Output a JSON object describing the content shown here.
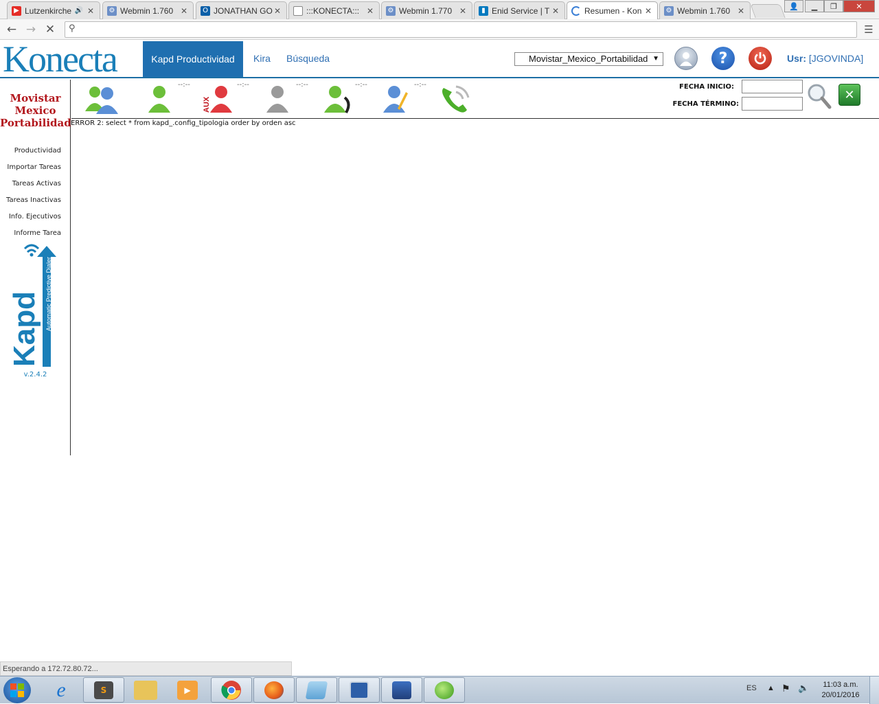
{
  "browser": {
    "tabs": [
      {
        "title": "Lutzenkirche",
        "icon": "youtube-icon",
        "audio": true
      },
      {
        "title": "Webmin 1.760",
        "icon": "webmin-icon"
      },
      {
        "title": "JONATHAN GO",
        "icon": "outlook-icon"
      },
      {
        "title": ":::KONECTA:::",
        "icon": "page-icon"
      },
      {
        "title": "Webmin 1.770",
        "icon": "webmin-icon"
      },
      {
        "title": "Enid Service | T",
        "icon": "trello-icon"
      },
      {
        "title": "Resumen - Kon",
        "icon": "loading-icon",
        "active": true
      },
      {
        "title": "Webmin 1.760",
        "icon": "webmin-icon"
      }
    ],
    "url": ""
  },
  "app": {
    "logo": "Konecta",
    "nav": {
      "active": "Kapd Productividad",
      "items": [
        "Kira",
        "Búsqueda"
      ]
    },
    "campaign_selected": "Movistar_Mexico_Portabilidad",
    "user_label": "Usr:",
    "user_name": "[JGOVINDA]"
  },
  "sidebar": {
    "client_lines": [
      "Movistar",
      "Mexico",
      "Portabilidad"
    ],
    "menu": [
      "Productividad",
      "Importar Tareas",
      "Tareas Activas",
      "Tareas Inactivas",
      "Info. Ejecutivos",
      "Informe Tarea"
    ],
    "kapd_tagline": "Automatic Predictive Dialer",
    "version": "v.2.4.2"
  },
  "status_icons": [
    {
      "name": "all-agents",
      "counter": ""
    },
    {
      "name": "available-agent",
      "counter": "--:--"
    },
    {
      "name": "aux-agent",
      "counter": "--:--"
    },
    {
      "name": "offline-agent",
      "counter": "--:--"
    },
    {
      "name": "on-call-agent",
      "counter": "--:--"
    },
    {
      "name": "editing-agent",
      "counter": "--:--"
    },
    {
      "name": "calls",
      "counter": ""
    }
  ],
  "filters": {
    "start_label": "FECHA INICIO:",
    "end_label": "FECHA TÉRMINO:",
    "start_value": "",
    "end_value": ""
  },
  "error_message": "ERROR 2: select * from kapd_.config_tipologia order by orden asc",
  "status_bar": "Esperando a 172.72.80.72...",
  "taskbar": {
    "language": "ES",
    "time": "11:03 a.m.",
    "date": "20/01/2016"
  },
  "colors": {
    "brand": "#1a7fb8",
    "nav_active": "#1f6fb0",
    "client": "#b3181e"
  }
}
